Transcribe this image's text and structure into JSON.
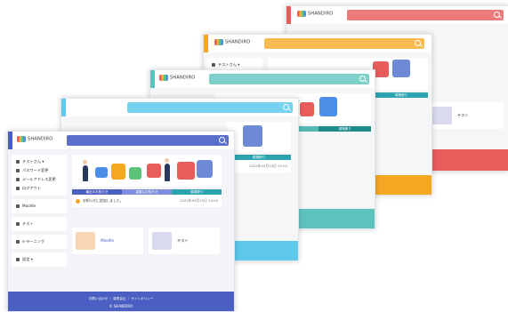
{
  "brand": {
    "name": "SHANDIRO",
    "copyright": "© SHANDIRO"
  },
  "colors": {
    "win1": "#e85c5c",
    "win2": "#f5a623",
    "win3": "#5fc3bd",
    "win4": "#5dc8ea",
    "win5": "#4a5fc1"
  },
  "sidebar": {
    "user": "テストさん ▾",
    "items": [
      {
        "label": "パスワード変更",
        "icon": "key-icon"
      },
      {
        "label": "メールアドレス変更",
        "icon": "mail-icon"
      },
      {
        "label": "ログアウト",
        "icon": "logout-icon"
      }
    ],
    "nav": [
      {
        "label": "Moodle",
        "icon": "grid-icon"
      },
      {
        "label": "テスト",
        "icon": "grid-icon"
      },
      {
        "label": "e-ラーニング",
        "icon": "book-icon"
      },
      {
        "label": "設定 ▾",
        "icon": "gear-icon"
      }
    ]
  },
  "tabs": [
    "最近のお知らせ",
    "重要なお知らせ",
    "現場便り"
  ],
  "news": {
    "text": "お知らせに追加しました。",
    "date": "2022年05月10日 10:00"
  },
  "cards": [
    {
      "label": "Moodle"
    },
    {
      "label": "テスト"
    }
  ],
  "footer": {
    "links": "お問い合わせ ｜ 運営会社 ｜ サイトポリシー"
  }
}
